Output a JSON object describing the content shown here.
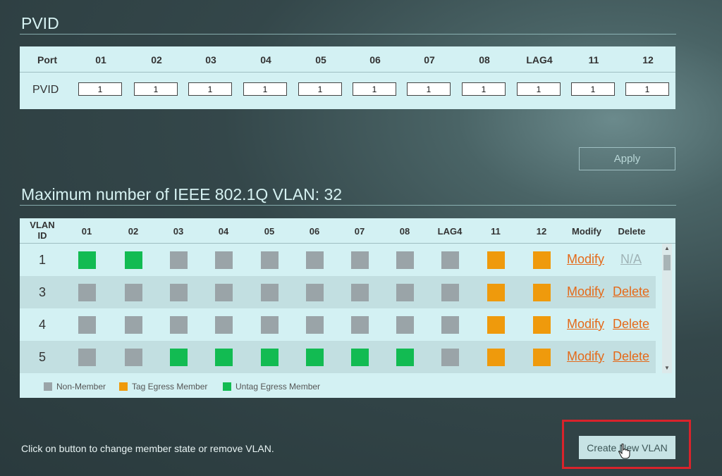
{
  "pvid_section": {
    "title": "PVID",
    "port_header": "Port",
    "row_label": "PVID",
    "ports": [
      "01",
      "02",
      "03",
      "04",
      "05",
      "06",
      "07",
      "08",
      "LAG4",
      "11",
      "12"
    ],
    "values": [
      "1",
      "1",
      "1",
      "1",
      "1",
      "1",
      "1",
      "1",
      "1",
      "1",
      "1"
    ]
  },
  "apply_label": "Apply",
  "vlan_section": {
    "title": "Maximum number of IEEE 802.1Q VLAN: 32",
    "header_vlan_id": "VLAN\nID",
    "header_ports": [
      "01",
      "02",
      "03",
      "04",
      "05",
      "06",
      "07",
      "08",
      "LAG4",
      "11",
      "12"
    ],
    "header_modify": "Modify",
    "header_delete": "Delete",
    "rows": [
      {
        "id": "1",
        "states": [
          "untag",
          "untag",
          "nm",
          "nm",
          "nm",
          "nm",
          "nm",
          "nm",
          "nm",
          "tag",
          "tag"
        ],
        "modify": "Modify",
        "delete": "N/A"
      },
      {
        "id": "3",
        "states": [
          "nm",
          "nm",
          "nm",
          "nm",
          "nm",
          "nm",
          "nm",
          "nm",
          "nm",
          "tag",
          "tag"
        ],
        "modify": "Modify",
        "delete": "Delete"
      },
      {
        "id": "4",
        "states": [
          "nm",
          "nm",
          "nm",
          "nm",
          "nm",
          "nm",
          "nm",
          "nm",
          "nm",
          "tag",
          "tag"
        ],
        "modify": "Modify",
        "delete": "Delete"
      },
      {
        "id": "5",
        "states": [
          "nm",
          "nm",
          "untag",
          "untag",
          "untag",
          "untag",
          "untag",
          "untag",
          "nm",
          "tag",
          "tag"
        ],
        "modify": "Modify",
        "delete": "Delete"
      }
    ],
    "legend": {
      "non_member": "Non-Member",
      "tag": "Tag Egress Member",
      "untag": "Untag Egress Member"
    }
  },
  "colors": {
    "non_member": "#9aa4a8",
    "tag": "#ef9a0c",
    "untag": "#12bb52",
    "link": "#e46a1a"
  },
  "hint": "Click on button to change member state or remove VLAN.",
  "create_label": "Create New VLAN"
}
